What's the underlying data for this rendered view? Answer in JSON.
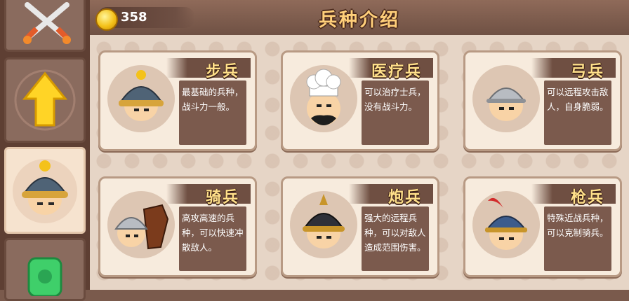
{
  "header": {
    "coin_count": "358",
    "title": "兵种介绍"
  },
  "sidebar": {
    "tabs": [
      {
        "name": "battle",
        "icon": "crossed-swords-icon"
      },
      {
        "name": "upgrade",
        "icon": "up-arrow-icon"
      },
      {
        "name": "troops",
        "icon": "soldier-helmet-icon",
        "active": true
      },
      {
        "name": "gem",
        "icon": "jade-token-icon"
      }
    ]
  },
  "units": [
    {
      "name": "步兵",
      "desc": "最基础的兵种，战斗力一般。",
      "icon": "infantry-helmet-icon"
    },
    {
      "name": "医疗兵",
      "desc": "可以治疗士兵，没有战斗力。",
      "icon": "chef-medic-icon"
    },
    {
      "name": "弓兵",
      "desc": "可以远程攻击敌人，自身脆弱。",
      "icon": "archer-helmet-icon"
    },
    {
      "name": "骑兵",
      "desc": "高攻高速的兵种，可以快速冲散敌人。",
      "icon": "cavalry-horse-icon"
    },
    {
      "name": "炮兵",
      "desc": "强大的远程兵种，可以对敌人造成范围伤害。",
      "icon": "artillery-helmet-icon"
    },
    {
      "name": "枪兵",
      "desc": "特殊近战兵种，可以克制骑兵。",
      "icon": "spearman-helmet-icon"
    }
  ],
  "colors": {
    "accent_gold": "#ffcf7a",
    "card_bg": "#f7ebdd",
    "desc_bg": "#7b5a4d",
    "header_bg": "#8f6a59"
  }
}
